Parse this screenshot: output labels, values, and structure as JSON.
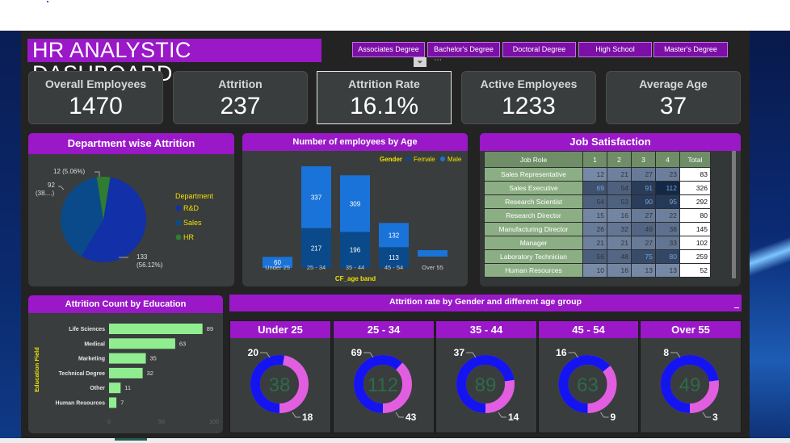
{
  "title": "HR ANALYSTIC DASHBOARD",
  "slicers": [
    "Associates Degree",
    "Bachelor's Degree",
    "Doctoral Degree",
    "High School",
    "Master's Degree"
  ],
  "kpis": [
    {
      "label": "Overall Employees",
      "value": "1470"
    },
    {
      "label": "Attrition",
      "value": "237"
    },
    {
      "label": "Attrition Rate",
      "value": "16.1%"
    },
    {
      "label": "Active Employees",
      "value": "1233"
    },
    {
      "label": "Average Age",
      "value": "37"
    }
  ],
  "dept": {
    "title": "Department wise Attrition",
    "legend_title": "Department",
    "labels": [
      "12 (5.06%)",
      "92",
      "(38....)",
      "133",
      "(56.12%)"
    ],
    "chart_data": {
      "type": "pie",
      "categories": [
        "R&D",
        "Sales",
        "HR"
      ],
      "values": [
        133,
        92,
        12
      ],
      "colors": [
        "#1230a8",
        "#0b4a8a",
        "#2e7d32"
      ],
      "legend_placement": "right"
    }
  },
  "age": {
    "title": "Number of employees by Age",
    "legend_title": "Gender",
    "xlabel": "CF_age band",
    "chart_data": {
      "type": "bar",
      "stacked": true,
      "categories": [
        "Under 25",
        "25 - 34",
        "35 - 44",
        "45 - 54",
        "Over 55"
      ],
      "series": [
        {
          "name": "Female",
          "values": [
            null,
            217,
            196,
            113,
            null
          ],
          "color": "#0b4a8a"
        },
        {
          "name": "Male",
          "values": [
            60,
            337,
            309,
            132,
            null
          ],
          "color": "#1a73d9"
        }
      ],
      "data_labels": [
        [
          "",
          "217",
          "196",
          "113",
          ""
        ],
        [
          "60",
          "337",
          "309",
          "132",
          ""
        ]
      ],
      "legend_placement": "top-right"
    }
  },
  "job": {
    "title": "Job Satisfaction",
    "headers": [
      "Job Role",
      "1",
      "2",
      "3",
      "4",
      "Total"
    ],
    "rows": [
      [
        "Sales Representative",
        "12",
        "21",
        "27",
        "23",
        "83"
      ],
      [
        "Sales Executive",
        "69",
        "54",
        "91",
        "112",
        "326"
      ],
      [
        "Research Scientist",
        "54",
        "53",
        "90",
        "95",
        "292"
      ],
      [
        "Research Director",
        "15",
        "16",
        "27",
        "22",
        "80"
      ],
      [
        "Manufacturing Director",
        "26",
        "32",
        "49",
        "38",
        "145"
      ],
      [
        "Manager",
        "21",
        "21",
        "27",
        "33",
        "102"
      ],
      [
        "Laboratory Technician",
        "56",
        "48",
        "75",
        "80",
        "259"
      ],
      [
        "Human Resources",
        "10",
        "16",
        "13",
        "13",
        "52"
      ]
    ]
  },
  "edu": {
    "title": "Attrition Count by Education",
    "ylabel": "Education Field",
    "chart_data": {
      "type": "bar",
      "orientation": "horizontal",
      "categories": [
        "Life Sciences",
        "Medical",
        "Marketing",
        "Technical Degree",
        "Other",
        "Human Resources"
      ],
      "values": [
        89,
        63,
        35,
        32,
        11,
        7
      ],
      "xlim": [
        0,
        100
      ],
      "xticks": [
        "0",
        "50",
        "100"
      ],
      "color": "#90ee90"
    }
  },
  "gender_title": "Attrition rate by Gender and different age group",
  "donuts": {
    "chart_data": [
      {
        "type": "pie",
        "title": "Under 25",
        "center": "38",
        "values": [
          20,
          18
        ]
      },
      {
        "type": "pie",
        "title": "25 - 34",
        "center": "112",
        "values": [
          69,
          43
        ]
      },
      {
        "type": "pie",
        "title": "35 - 44",
        "center": "89",
        "values": [
          37,
          14
        ]
      },
      {
        "type": "pie",
        "title": "45 - 54",
        "center": "63",
        "values": [
          16,
          9
        ]
      },
      {
        "type": "pie",
        "title": "Over 55",
        "center": "49",
        "values": [
          8,
          3
        ]
      }
    ],
    "colors": [
      "#1414f0",
      "#e15ee0"
    ]
  }
}
